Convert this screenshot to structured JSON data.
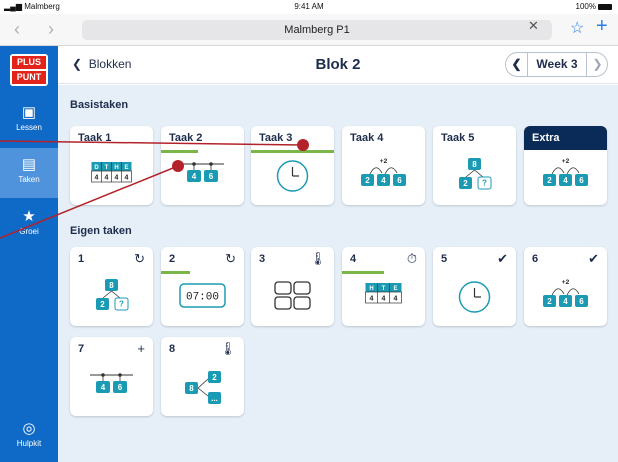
{
  "status": {
    "carrier": "Malmberg",
    "time": "9:41 AM",
    "battery": "100%"
  },
  "browser": {
    "url": "Malmberg P1"
  },
  "sidebar": {
    "logo": [
      "PLUS",
      "PUNT"
    ],
    "items": [
      {
        "label": "Lessen",
        "icon": "lessons-icon"
      },
      {
        "label": "Taken",
        "icon": "tasks-icon"
      },
      {
        "label": "Groei",
        "icon": "trophy-icon"
      },
      {
        "label": "Hulpkit",
        "icon": "lifebuoy-icon"
      }
    ]
  },
  "header": {
    "back": "Blokken",
    "title": "Blok 2",
    "week": "Week 3"
  },
  "sections": {
    "basis": "Basistaken",
    "eigen": "Eigen taken"
  },
  "basis_cards": [
    {
      "name": "Taak 1",
      "illustration": "place-value-table",
      "progress": 0
    },
    {
      "name": "Taak 2",
      "illustration": "number-line-blocks",
      "progress": 0.45
    },
    {
      "name": "Taak 3",
      "illustration": "clock",
      "progress": 1.0
    },
    {
      "name": "Taak 4",
      "illustration": "jump-sequence",
      "progress": 0
    },
    {
      "name": "Taak 5",
      "illustration": "split-tree",
      "progress": 0
    },
    {
      "name": "Extra",
      "illustration": "jump-sequence",
      "progress": 0
    }
  ],
  "eigen_cards": [
    {
      "name": "1",
      "icon": "repeat-icon",
      "illustration": "split-tree",
      "progress": 0
    },
    {
      "name": "2",
      "icon": "repeat-icon",
      "illustration": "digital-clock",
      "progress": 0.35
    },
    {
      "name": "3",
      "icon": "thermometer-icon",
      "illustration": "grid-boxes",
      "progress": 0
    },
    {
      "name": "4",
      "icon": "stopwatch-icon",
      "illustration": "place-value-table",
      "progress": 0.5
    },
    {
      "name": "5",
      "icon": "check-circle-icon",
      "illustration": "clock",
      "progress": 0
    },
    {
      "name": "6",
      "icon": "check-circle-icon",
      "illustration": "jump-sequence",
      "progress": 0
    },
    {
      "name": "7",
      "icon": "plus-icon",
      "illustration": "number-line-blocks",
      "progress": 0
    },
    {
      "name": "8",
      "icon": "thermometer-icon",
      "illustration": "branch-tree",
      "progress": 0
    }
  ],
  "illustration_text": {
    "pv_headers": [
      "D",
      "T",
      "H",
      "E"
    ],
    "pv_values": [
      "4",
      "4",
      "4",
      "4"
    ],
    "pv3_headers": [
      "H",
      "T",
      "E"
    ],
    "pv3_values": [
      "4",
      "4",
      "4"
    ],
    "blocks": [
      "4",
      "6"
    ],
    "jump_label": "+2",
    "seq": [
      "2",
      "4",
      "6"
    ],
    "tree_top": "8",
    "tree_left": "2",
    "tree_right": "?",
    "digital_time": "07:00",
    "branch_top": "2",
    "branch_left": "8",
    "branch_bottom": "..."
  },
  "colors": {
    "accent": "#0f69c6",
    "teal": "#1b9bb3",
    "progress": "#7ab648",
    "annotation": "#b3222a",
    "dark_card": "#0a2b57"
  }
}
